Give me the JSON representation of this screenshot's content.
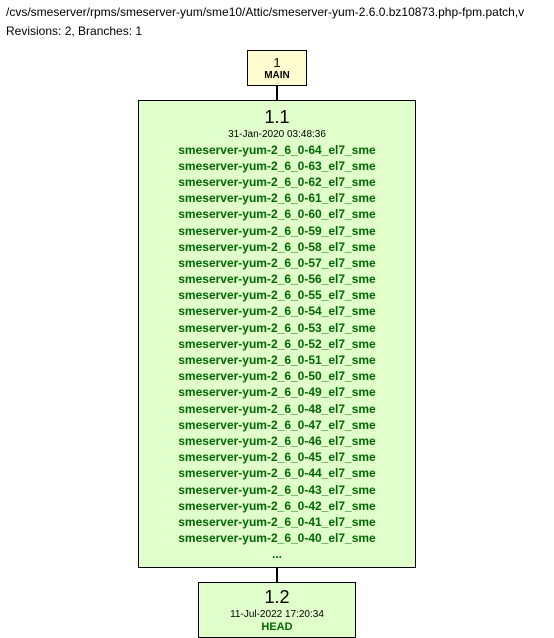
{
  "header": {
    "path": "/cvs/smeserver/rpms/smeserver-yum/sme10/Attic/smeserver-yum-2.6.0.bz10873.php-fpm.patch,v",
    "meta": "Revisions: 2, Branches: 1"
  },
  "branch_node": {
    "number": "1",
    "label": "MAIN"
  },
  "rev_1_1": {
    "version": "1.1",
    "date": "31-Jan-2020 03:48:36",
    "tags": [
      "smeserver-yum-2_6_0-64_el7_sme",
      "smeserver-yum-2_6_0-63_el7_sme",
      "smeserver-yum-2_6_0-62_el7_sme",
      "smeserver-yum-2_6_0-61_el7_sme",
      "smeserver-yum-2_6_0-60_el7_sme",
      "smeserver-yum-2_6_0-59_el7_sme",
      "smeserver-yum-2_6_0-58_el7_sme",
      "smeserver-yum-2_6_0-57_el7_sme",
      "smeserver-yum-2_6_0-56_el7_sme",
      "smeserver-yum-2_6_0-55_el7_sme",
      "smeserver-yum-2_6_0-54_el7_sme",
      "smeserver-yum-2_6_0-53_el7_sme",
      "smeserver-yum-2_6_0-52_el7_sme",
      "smeserver-yum-2_6_0-51_el7_sme",
      "smeserver-yum-2_6_0-50_el7_sme",
      "smeserver-yum-2_6_0-49_el7_sme",
      "smeserver-yum-2_6_0-48_el7_sme",
      "smeserver-yum-2_6_0-47_el7_sme",
      "smeserver-yum-2_6_0-46_el7_sme",
      "smeserver-yum-2_6_0-45_el7_sme",
      "smeserver-yum-2_6_0-44_el7_sme",
      "smeserver-yum-2_6_0-43_el7_sme",
      "smeserver-yum-2_6_0-42_el7_sme",
      "smeserver-yum-2_6_0-41_el7_sme",
      "smeserver-yum-2_6_0-40_el7_sme"
    ],
    "ellipsis": "..."
  },
  "rev_1_2": {
    "version": "1.2",
    "date": "11-Jul-2022 17:20:34",
    "head": "HEAD"
  }
}
